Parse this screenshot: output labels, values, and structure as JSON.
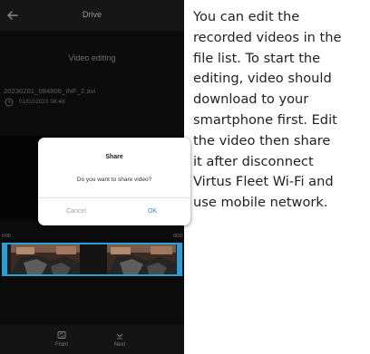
{
  "appbar": {
    "title": "Drive",
    "back_icon": "arrow-left-icon"
  },
  "screen": {
    "section_title": "Video editing",
    "file": {
      "name": "20230201_084806_INF_2.avi",
      "date": "01/02/2023 08:48"
    }
  },
  "dialog": {
    "title": "Share",
    "message": "Do you want to share video?",
    "cancel_label": "Cancel",
    "ok_label": "OK"
  },
  "timeline": {
    "start": "0:00",
    "end": "00:0"
  },
  "bottom_bar": {
    "front_label": "Front",
    "next_label": "Next",
    "front_icon": "camera-switch-icon",
    "next_icon": "chevron-down-icon"
  },
  "caption": {
    "lines": [
      "You can edit the",
      "recorded videos in the",
      "file list. To start the",
      "editing, video should",
      "download to your",
      "smartphone first. Edit",
      "the video then share",
      "it after disconnect",
      "Virtus Fleet Wi-Fi and",
      "use mobile network."
    ]
  },
  "colors": {
    "accent": "#2a9fd6",
    "ok": "#2f8cd6",
    "background": "#0b0b0b"
  }
}
